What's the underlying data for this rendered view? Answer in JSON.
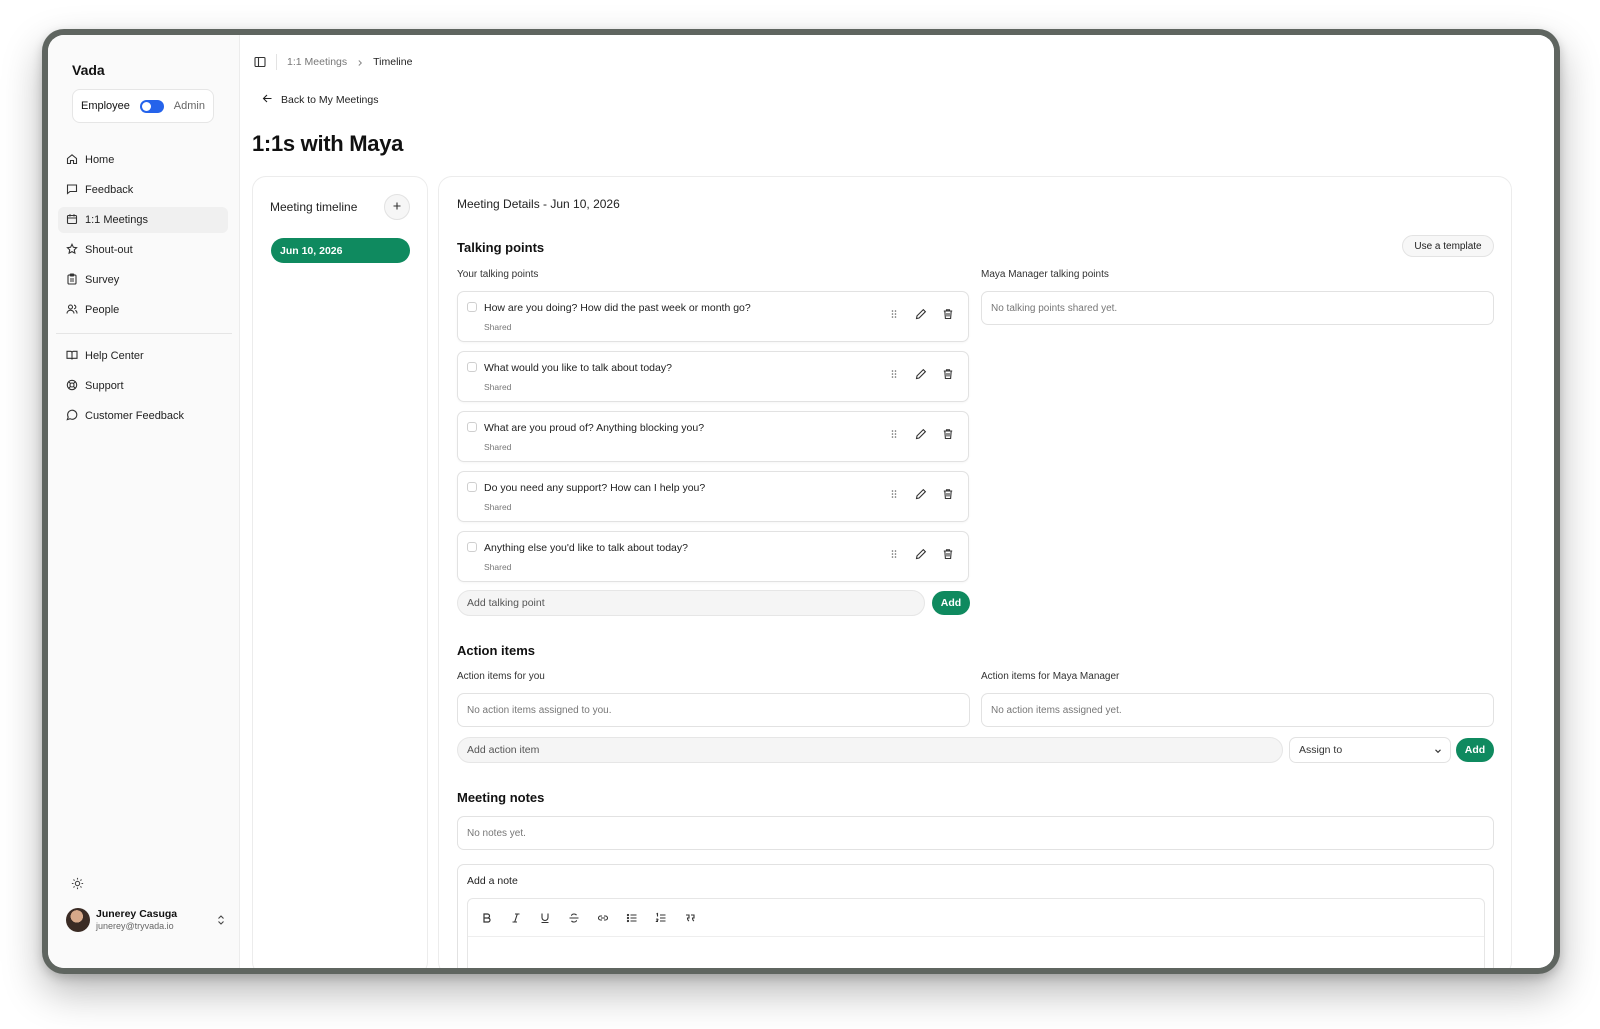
{
  "app": {
    "name": "Vada"
  },
  "role_switch": {
    "employee": "Employee",
    "admin": "Admin"
  },
  "nav": {
    "primary": [
      "Home",
      "Feedback",
      "1:1 Meetings",
      "Shout-out",
      "Survey",
      "People"
    ],
    "secondary": [
      "Help Center",
      "Support",
      "Customer Feedback"
    ],
    "active": "1:1 Meetings"
  },
  "user": {
    "name": "Junerey Casuga",
    "email": "junerey@tryvada.io"
  },
  "breadcrumb": {
    "parent": "1:1 Meetings",
    "current": "Timeline"
  },
  "back_link": "Back to My Meetings",
  "page_title": "1:1s with Maya",
  "timeline": {
    "title": "Meeting timeline",
    "dates": [
      "Jun 10, 2026"
    ]
  },
  "details": {
    "title": "Meeting Details - Jun 10, 2026",
    "talking_points": {
      "heading": "Talking points",
      "template_button": "Use a template",
      "yours_label": "Your talking points",
      "theirs_label": "Maya Manager talking points",
      "theirs_empty": "No talking points shared yet.",
      "items": [
        {
          "text": "How are you doing? How did the past week or month go?",
          "status": "Shared"
        },
        {
          "text": "What would you like to talk about today?",
          "status": "Shared"
        },
        {
          "text": "What are you proud of? Anything blocking you?",
          "status": "Shared"
        },
        {
          "text": "Do you need any support? How can I help you?",
          "status": "Shared"
        },
        {
          "text": "Anything else you'd like to talk about today?",
          "status": "Shared"
        }
      ],
      "add_placeholder": "Add talking point",
      "add_button": "Add"
    },
    "action_items": {
      "heading": "Action items",
      "yours_label": "Action items for you",
      "yours_empty": "No action items assigned to you.",
      "theirs_label": "Action items for Maya Manager",
      "theirs_empty": "No action items assigned yet.",
      "add_placeholder": "Add action item",
      "assign_select": "Assign to",
      "add_button": "Add"
    },
    "notes": {
      "heading": "Meeting notes",
      "empty": "No notes yet.",
      "add_label": "Add a note"
    }
  },
  "colors": {
    "accent": "#0f8a5f",
    "toggle": "#2563eb"
  }
}
